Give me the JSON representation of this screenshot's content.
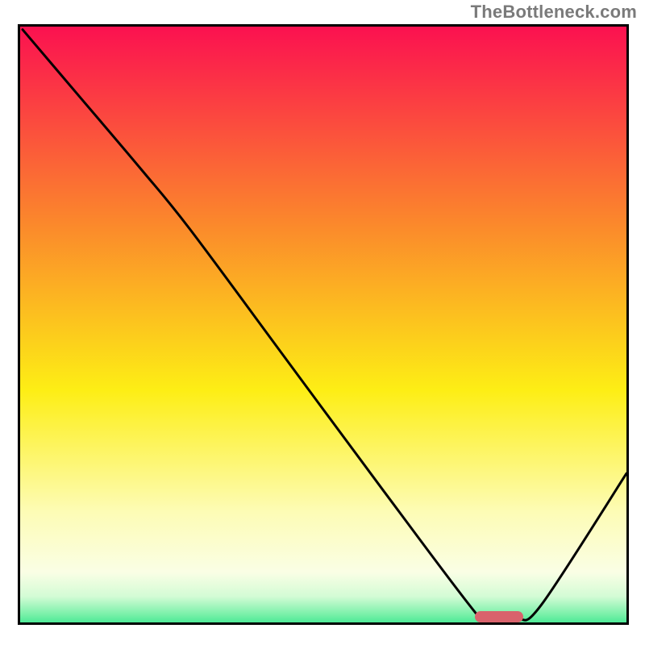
{
  "watermark": "TheBottleneck.com",
  "chart_data": {
    "type": "line",
    "title": "",
    "xlabel": "",
    "ylabel": "",
    "xlim": [
      0,
      100
    ],
    "ylim": [
      0,
      100
    ],
    "grid": false,
    "legend": false,
    "series": [
      {
        "name": "curve",
        "x": [
          0.4,
          10,
          20,
          28,
          44,
          60,
          76,
          78,
          82,
          86,
          100
        ],
        "y": [
          99.5,
          88,
          76,
          66,
          44,
          22,
          0.5,
          0.5,
          0.5,
          3,
          25
        ]
      }
    ],
    "marker": {
      "x_start": 75,
      "x_end": 83,
      "y": 0.7,
      "color": "#d9626c"
    },
    "gradient_stops": [
      {
        "offset": 0,
        "color": "#fb1150"
      },
      {
        "offset": 33,
        "color": "#fb8a2b"
      },
      {
        "offset": 60,
        "color": "#fdee15"
      },
      {
        "offset": 80,
        "color": "#fdfcb5"
      },
      {
        "offset": 90,
        "color": "#fafee5"
      },
      {
        "offset": 94,
        "color": "#d3fcd5"
      },
      {
        "offset": 97,
        "color": "#78f0a8"
      },
      {
        "offset": 100,
        "color": "#16e180"
      }
    ]
  }
}
